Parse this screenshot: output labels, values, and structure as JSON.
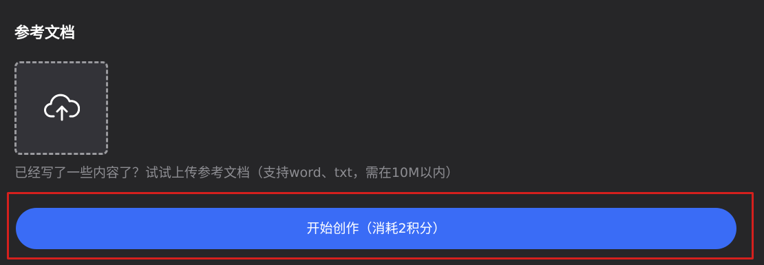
{
  "reference_doc": {
    "title": "参考文档",
    "upload_icon": "cloud-upload-icon",
    "hint": "已经写了一些内容了？试试上传参考文档（支持word、txt，需在10M以内）"
  },
  "actions": {
    "submit_label": "开始创作（消耗2积分）"
  },
  "colors": {
    "background": "#262628",
    "accent": "#3a6cf6",
    "highlight": "#d6201d"
  }
}
